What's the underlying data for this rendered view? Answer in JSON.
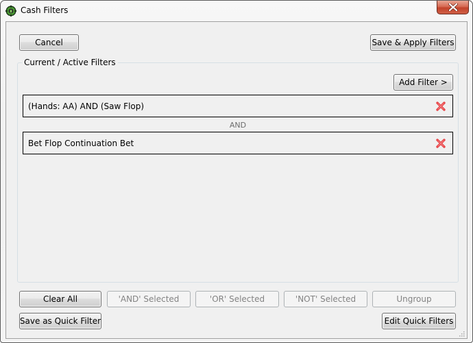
{
  "window": {
    "title": "Cash Filters",
    "app_icon": "poker-chip-icon",
    "close_icon": "close-icon"
  },
  "top_buttons": {
    "cancel": "Cancel",
    "save_apply": "Save & Apply Filters"
  },
  "active_filters": {
    "group_label": "Current / Active Filters",
    "add_filter": "Add Filter >",
    "filters": [
      {
        "text": "(Hands: AA) AND (Saw Flop)",
        "remove_icon": "remove-x-icon"
      },
      {
        "text": "Bet Flop Continuation Bet",
        "remove_icon": "remove-x-icon"
      }
    ],
    "connector": "AND",
    "remove_color": "#e8474a"
  },
  "bottom_buttons": {
    "clear_all": "Clear All",
    "and_selected": "'AND' Selected",
    "or_selected": "'OR' Selected",
    "not_selected": "'NOT' Selected",
    "ungroup": "Ungroup",
    "save_quick": "Save as Quick Filter",
    "edit_quick": "Edit Quick Filters"
  }
}
